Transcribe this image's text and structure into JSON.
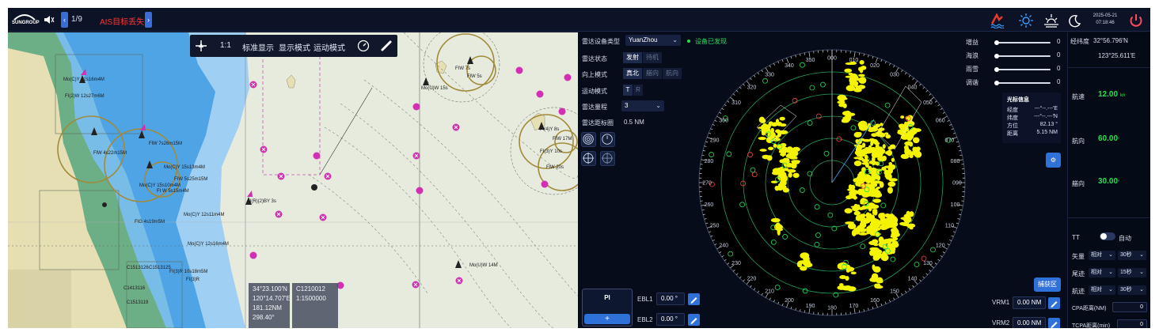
{
  "topbar": {
    "brand": "SUNGROUP",
    "page_indicator": "1/9",
    "alarm_text": "AIS目标丢失",
    "date": "2025-05-21",
    "time": "07:18:46"
  },
  "chart_toolbar": {
    "scale": "1:1",
    "standard_display": "标准显示",
    "display_mode": "显示模式",
    "motion_mode": "运动模式"
  },
  "chart_labels": [
    "Mo(C)Y 12s16m4M",
    "FI(2)W 12s27m6M",
    "FlW 7s26m15M",
    "FlW 4s22m15M",
    "FI W 5s15m4M",
    "Mo(C)Y 15s13m4M",
    "FIW 5s25m15M",
    "Mo(C)Y 15s10m4M",
    "FIG 4s19m5M",
    "Mo(C)Y 12s11m4M",
    "Mo(C)Y 12s16m4M",
    "FI(3)R 10s18m5M",
    "FI(3)R",
    "Mo(U)W 15s",
    "FIW 7s",
    "FlW 5s",
    "Fl(4)Y 8s",
    "FI(3)Y 10s",
    "FIW 17M",
    "FlW 20s",
    "Al(R)(2)BY 3s",
    "Mo(U)W 14M",
    "C1513126",
    "C1513125",
    "C1413116",
    "C1513119"
  ],
  "chart_info": {
    "lat": "34°23.100'N",
    "lon": "120°14.707'E",
    "range": "181.12NM",
    "bearing": "298.40°",
    "chart_id": "C1210012",
    "chart_scale": "1:1500000"
  },
  "radar": {
    "device_type_label": "雷达设备类型",
    "device_type_value": "YuanZhou",
    "device_status": "设备已发现",
    "status_label": "雷达状态",
    "status_options": [
      "发射",
      "待机"
    ],
    "upmode_label": "向上模式",
    "upmode_options": [
      "真北",
      "艏向",
      "航向"
    ],
    "motion_label": "运动模式",
    "motion_options": [
      "T",
      "R"
    ],
    "range_label": "雷达量程",
    "range_value": "3",
    "rings_label": "雷达距标圈",
    "rings_value": "0.5 NM",
    "sliders": [
      {
        "label": "增益",
        "value": "0"
      },
      {
        "label": "海浪",
        "value": "0"
      },
      {
        "label": "雨雪",
        "value": "0"
      },
      {
        "label": "调谐",
        "value": "0"
      }
    ],
    "cursor_info": {
      "title": "光标信息",
      "rows": [
        {
          "k": "经度",
          "v": "---°--.---'E"
        },
        {
          "k": "纬度",
          "v": "---°--.---'N"
        },
        {
          "k": "方位",
          "v": "82.13 °"
        },
        {
          "k": "距离",
          "v": "5.15 NM"
        }
      ]
    },
    "bearing_labels": [
      "000",
      "010",
      "020",
      "030",
      "040",
      "050",
      "060",
      "070",
      "080",
      "090",
      "100",
      "110",
      "120",
      "130",
      "140",
      "150",
      "160",
      "170",
      "180",
      "190",
      "200",
      "210",
      "220",
      "230",
      "240",
      "250",
      "260",
      "270",
      "280",
      "290",
      "300",
      "310",
      "320",
      "330",
      "340",
      "350"
    ],
    "pi_label": "PI",
    "pi_add": "+",
    "ebl1_label": "EBL1",
    "ebl1_value": "0.00 °",
    "ebl2_label": "EBL2",
    "ebl2_value": "0.00 °",
    "capture_button": "捕获区",
    "vrm1_label": "VRM1",
    "vrm1_value": "0.00 NM",
    "vrm2_label": "VRM2",
    "vrm2_value": "0.00 NM"
  },
  "right_panel": {
    "latlon_label": "经纬度",
    "lat": "32°56.796'N",
    "lon": "123°25.611'E",
    "speed_label": "航速",
    "speed_value": "12.00",
    "speed_unit": "kn",
    "course_label": "航向",
    "course_value": "60.00",
    "course_unit": "°",
    "heading_label": "艏向",
    "heading_value": "30.00",
    "heading_unit": "°",
    "tt_label": "TT",
    "auto_label": "自动",
    "vector_label": "矢量",
    "vector_mode": "相对",
    "vector_time": "30秒",
    "trail_label": "尾迹",
    "trail_mode": "相对",
    "trail_time": "15秒",
    "track_label": "航迹",
    "track_mode": "相对",
    "track_time": "30秒",
    "cpa_label": "CPA距离(NM)",
    "cpa_value": "0",
    "tcpa_label": "TCPA距离(min)",
    "tcpa_value": "0"
  },
  "colors": {
    "radar_echo": "#f4f400",
    "target_green": "#22e05a",
    "alarm_red": "#ff3535",
    "accent_blue": "#2e71d9",
    "sea_blue": "#4fa4e6",
    "land_green": "#6cae86"
  }
}
